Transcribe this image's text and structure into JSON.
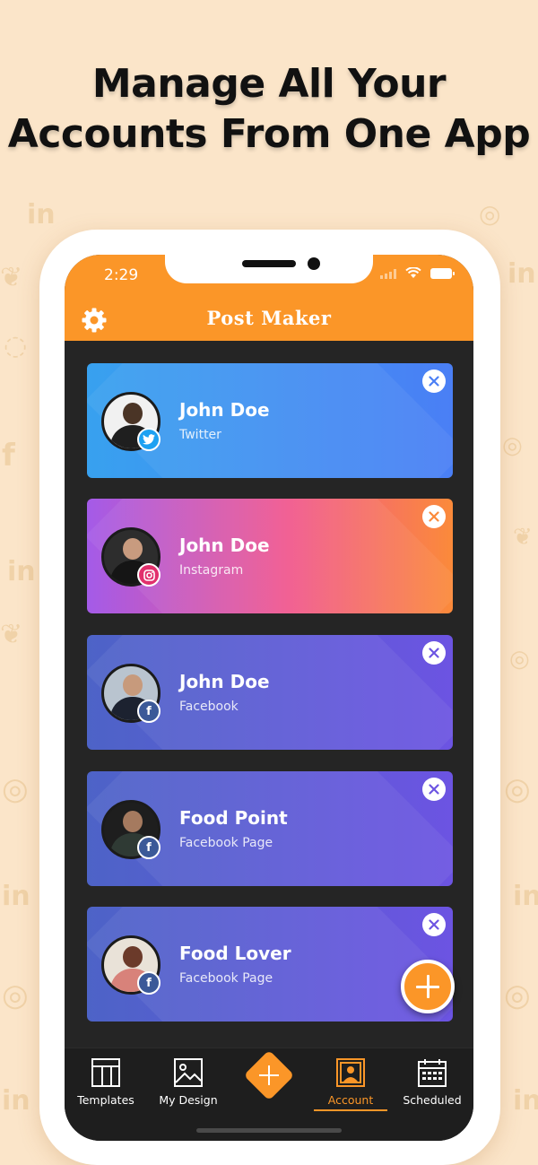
{
  "headline": {
    "line1": "Manage All Your",
    "line2": "Accounts From One App"
  },
  "status_bar": {
    "time": "2:29"
  },
  "app": {
    "title": "Post Maker"
  },
  "accounts": [
    {
      "name": "John Doe",
      "platform": "Twitter",
      "badge_icon": "twitter-icon",
      "gradient": [
        "#38a1ef",
        "#4a7ff5"
      ]
    },
    {
      "name": "John Doe",
      "platform": "Instagram",
      "badge_icon": "instagram-icon",
      "gradient": [
        "#a45be8",
        "#f1588e",
        "#fb8a3a"
      ]
    },
    {
      "name": "John Doe",
      "platform": "Facebook",
      "badge_icon": "facebook-icon",
      "gradient": [
        "#4d63c7",
        "#6c54e2"
      ]
    },
    {
      "name": "Food Point",
      "platform": "Facebook Page",
      "badge_icon": "facebook-icon",
      "gradient": [
        "#4d63c7",
        "#6c54e2"
      ]
    },
    {
      "name": "Food Lover",
      "platform": "Facebook Page",
      "badge_icon": "facebook-icon",
      "gradient": [
        "#4d63c7",
        "#6c54e2"
      ]
    }
  ],
  "bottom_nav": {
    "items": [
      {
        "label": "Templates",
        "icon": "templates-icon"
      },
      {
        "label": "My Design",
        "icon": "image-icon"
      },
      {
        "label": "",
        "icon": "add-icon"
      },
      {
        "label": "Account",
        "icon": "account-icon",
        "active": true
      },
      {
        "label": "Scheduled",
        "icon": "calendar-icon"
      }
    ]
  },
  "colors": {
    "accent": "#fb9628",
    "background": "#fbe5c9",
    "screen": "#252525"
  }
}
